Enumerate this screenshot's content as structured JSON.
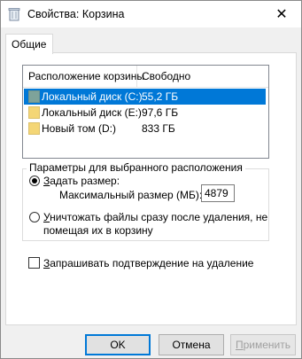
{
  "window": {
    "title": "Свойства: Корзина",
    "close_glyph": "✕"
  },
  "tabs": [
    {
      "label": "Общие"
    }
  ],
  "list": {
    "columns": [
      "Расположение корзины",
      "Свободно"
    ],
    "rows": [
      {
        "name": "Локальный диск (C:)",
        "free": "55,2 ГБ",
        "selected": true,
        "icon_color": "#7ea39a"
      },
      {
        "name": "Локальный диск (E:)",
        "free": "97,6 ГБ",
        "selected": false,
        "icon_color": "#f4d676"
      },
      {
        "name": "Новый том (D:)",
        "free": "833 ГБ",
        "selected": false,
        "icon_color": "#f4d676"
      }
    ]
  },
  "settings": {
    "group_title": "Параметры для выбранного расположения",
    "custom_size_label_accel": "З",
    "custom_size_label_rest": "адать размер:",
    "max_size_label": "Максимальный размер (МБ):",
    "max_size_value": "4879",
    "delete_immediately_accel": "У",
    "delete_immediately_line1_rest": "ничтожать файлы сразу после удаления, не",
    "delete_immediately_line2": "помещая их в корзину",
    "selected_option": "custom_size"
  },
  "confirm": {
    "accel": "З",
    "rest": "апрашивать подтверждение на удаление",
    "checked": false
  },
  "buttons": {
    "ok": "OK",
    "cancel": "Отмена",
    "apply_accel": "П",
    "apply_rest": "рименить"
  },
  "colors": {
    "accent": "#0078d7",
    "folder": "#f4d676"
  },
  "icons": {
    "title": "recycle-bin-icon",
    "drive": "drive-icon"
  }
}
